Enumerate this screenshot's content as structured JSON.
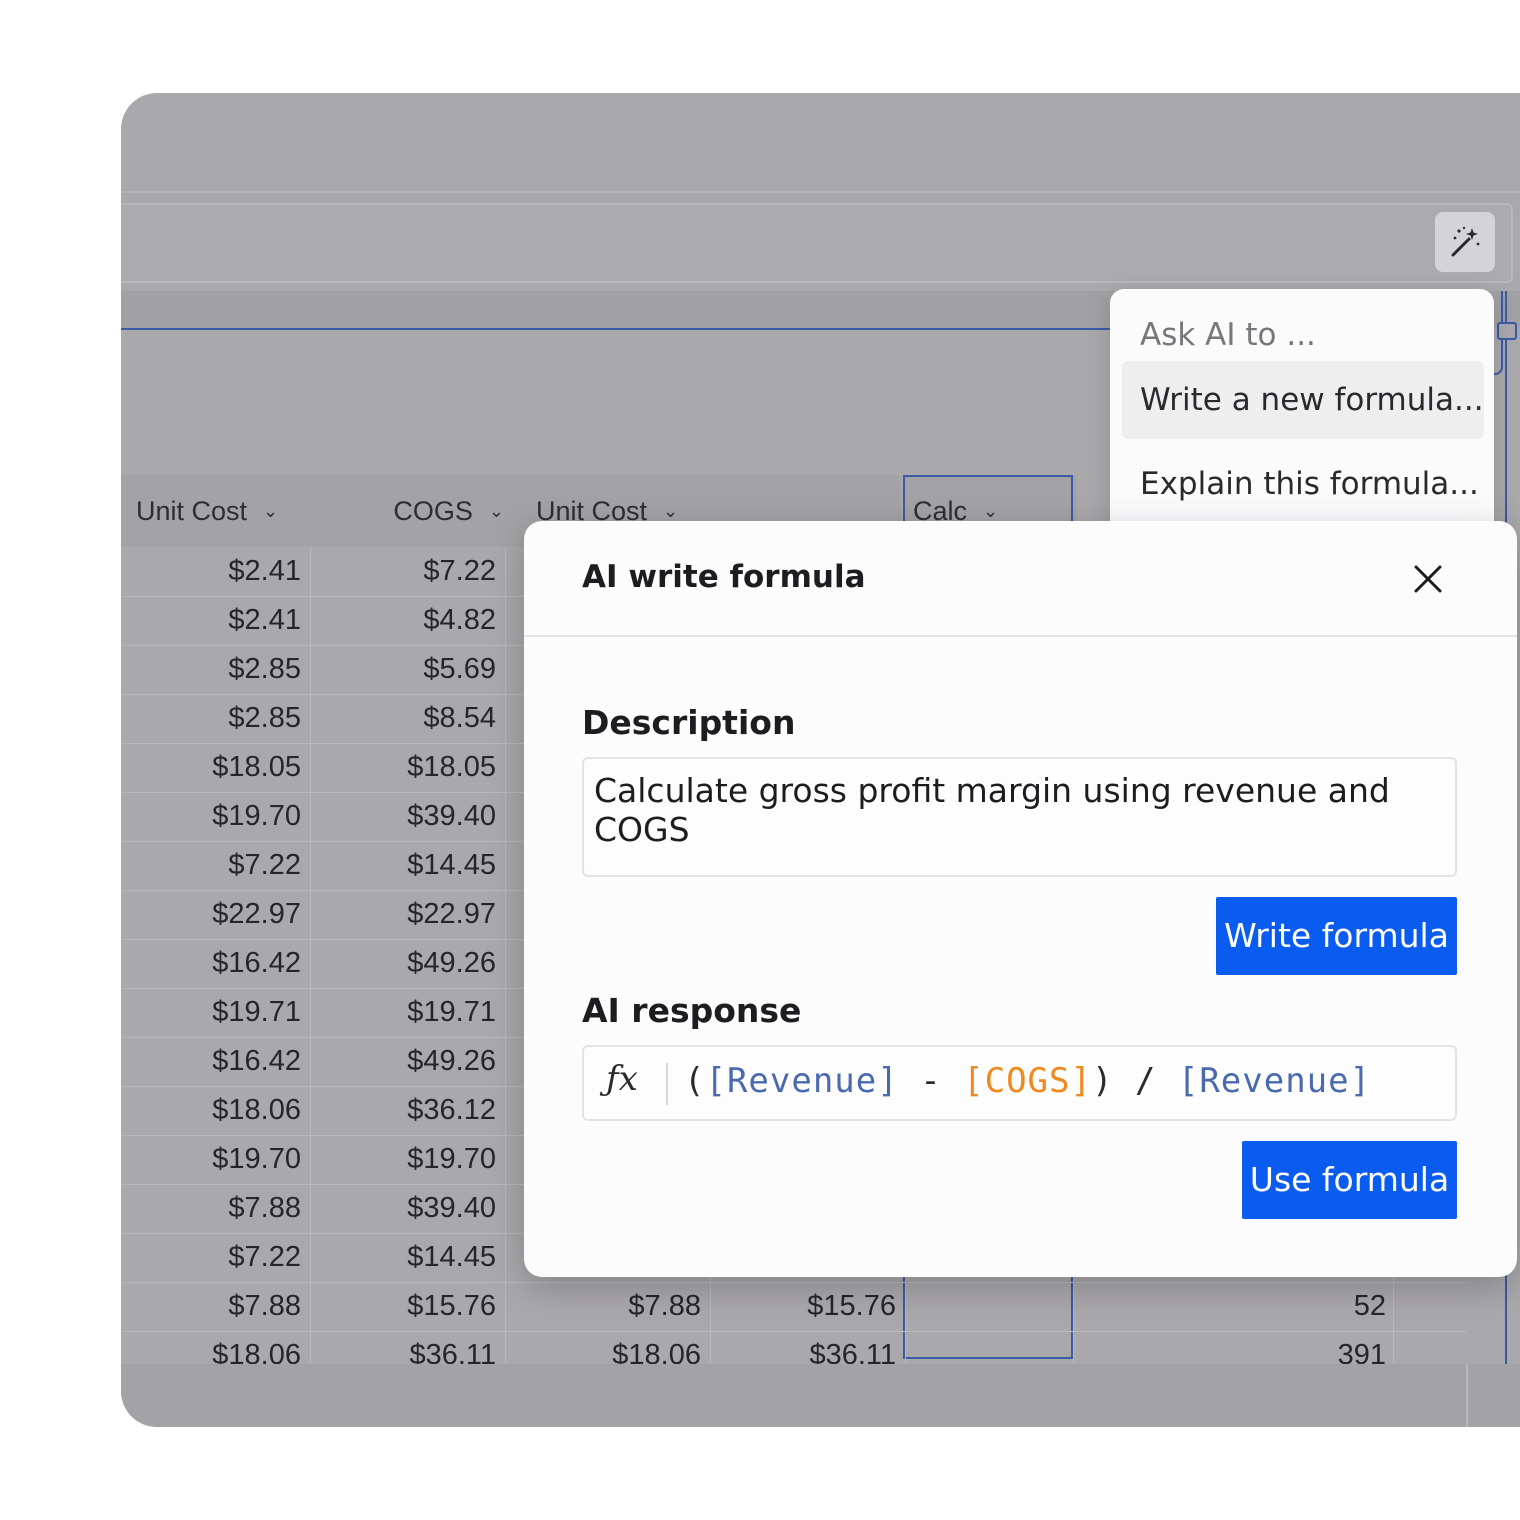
{
  "menu": {
    "title": "Ask AI to ...",
    "items": [
      "Write a new formula...",
      "Explain this formula..."
    ]
  },
  "table": {
    "headers": [
      "Unit Cost",
      "COGS",
      "Unit Cost",
      "",
      "Calc"
    ],
    "rows": [
      [
        "$2.41",
        "$7.22",
        "",
        "",
        "",
        ""
      ],
      [
        "$2.41",
        "$4.82",
        "",
        "",
        "",
        ""
      ],
      [
        "$2.85",
        "$5.69",
        "",
        "",
        "",
        ""
      ],
      [
        "$2.85",
        "$8.54",
        "",
        "",
        "",
        ""
      ],
      [
        "$18.05",
        "$18.05",
        "",
        "",
        "",
        ""
      ],
      [
        "$19.70",
        "$39.40",
        "",
        "",
        "",
        ""
      ],
      [
        "$7.22",
        "$14.45",
        "",
        "",
        "",
        ""
      ],
      [
        "$22.97",
        "$22.97",
        "",
        "",
        "",
        ""
      ],
      [
        "$16.42",
        "$49.26",
        "",
        "",
        "",
        ""
      ],
      [
        "$19.71",
        "$19.71",
        "",
        "",
        "",
        ""
      ],
      [
        "$16.42",
        "$49.26",
        "",
        "",
        "",
        ""
      ],
      [
        "$18.06",
        "$36.12",
        "",
        "",
        "",
        ""
      ],
      [
        "$19.70",
        "$19.70",
        "",
        "",
        "",
        ""
      ],
      [
        "$7.88",
        "$39.40",
        "",
        "",
        "",
        ""
      ],
      [
        "$7.22",
        "$14.45",
        "",
        "",
        "",
        ""
      ],
      [
        "$7.88",
        "$15.76",
        "$7.88",
        "$15.76",
        "",
        "52"
      ],
      [
        "$18.06",
        "$36.11",
        "$18.06",
        "$36.11",
        "",
        "391"
      ]
    ]
  },
  "dialog": {
    "title": "AI write formula",
    "description_label": "Description",
    "description_value": "Calculate gross profit margin using revenue and COGS",
    "write_button": "Write formula",
    "response_label": "AI response",
    "fx_symbol": "ƒx",
    "formula_tokens": [
      "(",
      "[Revenue]",
      " - ",
      "[COGS]",
      ") / ",
      "[Revenue]"
    ],
    "use_button": "Use formula"
  },
  "colors": {
    "accent": "#0a5cf0",
    "selection_border": "#3a5aa8",
    "ref_token": "#4a6ab0",
    "cogs_token": "#f08a1e"
  }
}
